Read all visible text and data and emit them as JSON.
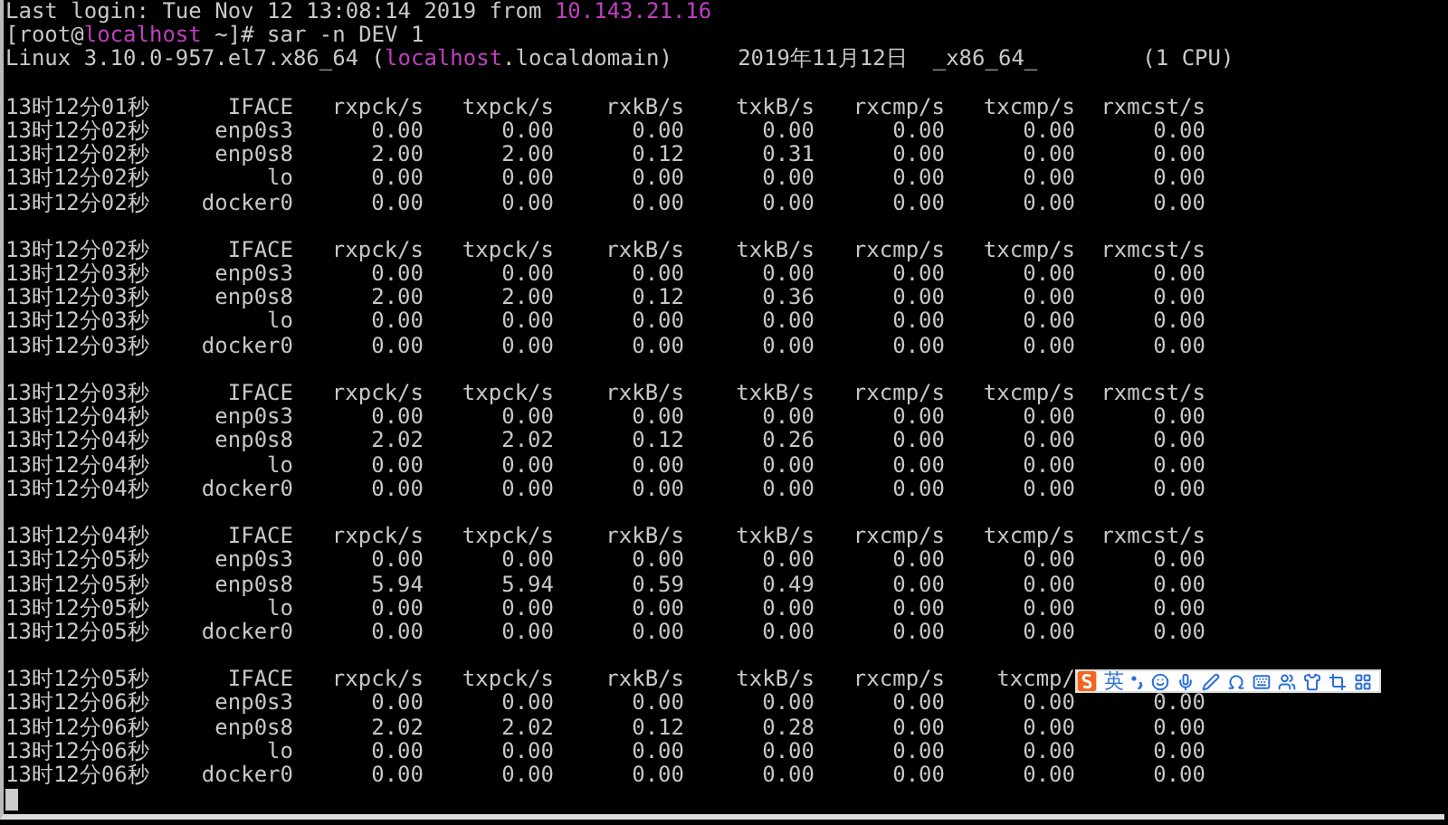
{
  "terminal": {
    "lines": [
      [
        {
          "text": "Last login: Tue Nov 12 13:08:14 2019 from ",
          "kind": "plain"
        },
        {
          "text": "10.143.21.16",
          "kind": "host"
        }
      ],
      [
        {
          "text": "[root@",
          "kind": "plain"
        },
        {
          "text": "localhost",
          "kind": "host"
        },
        {
          "text": " ~]# sar -n DEV 1",
          "kind": "plain"
        }
      ]
    ],
    "sysinfo": {
      "kernel": [
        {
          "text": "Linux 3.10.0-957.el7.x86_64 (",
          "kind": "plain"
        },
        {
          "text": "localhost",
          "kind": "host"
        },
        {
          "text": ".localdomain)",
          "kind": "plain"
        }
      ],
      "date": "2019年11月12日",
      "arch": "_x86_64_",
      "cpus": "(1 CPU)"
    },
    "blocks": [
      {
        "header": [
          "13时12分01秒",
          "IFACE",
          "rxpck/s",
          "txpck/s",
          "rxkB/s",
          "txkB/s",
          "rxcmp/s",
          "txcmp/s",
          "rxmcst/s"
        ],
        "rows": [
          [
            "13时12分02秒",
            "enp0s3",
            "0.00",
            "0.00",
            "0.00",
            "0.00",
            "0.00",
            "0.00",
            "0.00"
          ],
          [
            "13时12分02秒",
            "enp0s8",
            "2.00",
            "2.00",
            "0.12",
            "0.31",
            "0.00",
            "0.00",
            "0.00"
          ],
          [
            "13时12分02秒",
            "lo",
            "0.00",
            "0.00",
            "0.00",
            "0.00",
            "0.00",
            "0.00",
            "0.00"
          ],
          [
            "13时12分02秒",
            "docker0",
            "0.00",
            "0.00",
            "0.00",
            "0.00",
            "0.00",
            "0.00",
            "0.00"
          ]
        ]
      },
      {
        "header": [
          "13时12分02秒",
          "IFACE",
          "rxpck/s",
          "txpck/s",
          "rxkB/s",
          "txkB/s",
          "rxcmp/s",
          "txcmp/s",
          "rxmcst/s"
        ],
        "rows": [
          [
            "13时12分03秒",
            "enp0s3",
            "0.00",
            "0.00",
            "0.00",
            "0.00",
            "0.00",
            "0.00",
            "0.00"
          ],
          [
            "13时12分03秒",
            "enp0s8",
            "2.00",
            "2.00",
            "0.12",
            "0.36",
            "0.00",
            "0.00",
            "0.00"
          ],
          [
            "13时12分03秒",
            "lo",
            "0.00",
            "0.00",
            "0.00",
            "0.00",
            "0.00",
            "0.00",
            "0.00"
          ],
          [
            "13时12分03秒",
            "docker0",
            "0.00",
            "0.00",
            "0.00",
            "0.00",
            "0.00",
            "0.00",
            "0.00"
          ]
        ]
      },
      {
        "header": [
          "13时12分03秒",
          "IFACE",
          "rxpck/s",
          "txpck/s",
          "rxkB/s",
          "txkB/s",
          "rxcmp/s",
          "txcmp/s",
          "rxmcst/s"
        ],
        "rows": [
          [
            "13时12分04秒",
            "enp0s3",
            "0.00",
            "0.00",
            "0.00",
            "0.00",
            "0.00",
            "0.00",
            "0.00"
          ],
          [
            "13时12分04秒",
            "enp0s8",
            "2.02",
            "2.02",
            "0.12",
            "0.26",
            "0.00",
            "0.00",
            "0.00"
          ],
          [
            "13时12分04秒",
            "lo",
            "0.00",
            "0.00",
            "0.00",
            "0.00",
            "0.00",
            "0.00",
            "0.00"
          ],
          [
            "13时12分04秒",
            "docker0",
            "0.00",
            "0.00",
            "0.00",
            "0.00",
            "0.00",
            "0.00",
            "0.00"
          ]
        ]
      },
      {
        "header": [
          "13时12分04秒",
          "IFACE",
          "rxpck/s",
          "txpck/s",
          "rxkB/s",
          "txkB/s",
          "rxcmp/s",
          "txcmp/s",
          "rxmcst/s"
        ],
        "rows": [
          [
            "13时12分05秒",
            "enp0s3",
            "0.00",
            "0.00",
            "0.00",
            "0.00",
            "0.00",
            "0.00",
            "0.00"
          ],
          [
            "13时12分05秒",
            "enp0s8",
            "5.94",
            "5.94",
            "0.59",
            "0.49",
            "0.00",
            "0.00",
            "0.00"
          ],
          [
            "13时12分05秒",
            "lo",
            "0.00",
            "0.00",
            "0.00",
            "0.00",
            "0.00",
            "0.00",
            "0.00"
          ],
          [
            "13时12分05秒",
            "docker0",
            "0.00",
            "0.00",
            "0.00",
            "0.00",
            "0.00",
            "0.00",
            "0.00"
          ]
        ]
      },
      {
        "header": [
          "13时12分05秒",
          "IFACE",
          "rxpck/s",
          "txpck/s",
          "rxkB/s",
          "txkB/s",
          "rxcmp/s",
          "txcmp/"
        ],
        "rows": [
          [
            "13时12分06秒",
            "enp0s3",
            "0.00",
            "0.00",
            "0.00",
            "0.00",
            "0.00",
            "0.00",
            "0.00"
          ],
          [
            "13时12分06秒",
            "enp0s8",
            "2.02",
            "2.02",
            "0.12",
            "0.28",
            "0.00",
            "0.00",
            "0.00"
          ],
          [
            "13时12分06秒",
            "lo",
            "0.00",
            "0.00",
            "0.00",
            "0.00",
            "0.00",
            "0.00",
            "0.00"
          ],
          [
            "13时12分06秒",
            "docker0",
            "0.00",
            "0.00",
            "0.00",
            "0.00",
            "0.00",
            "0.00",
            "0.00"
          ]
        ]
      }
    ]
  },
  "ime_toolbar": {
    "mode": "英"
  }
}
